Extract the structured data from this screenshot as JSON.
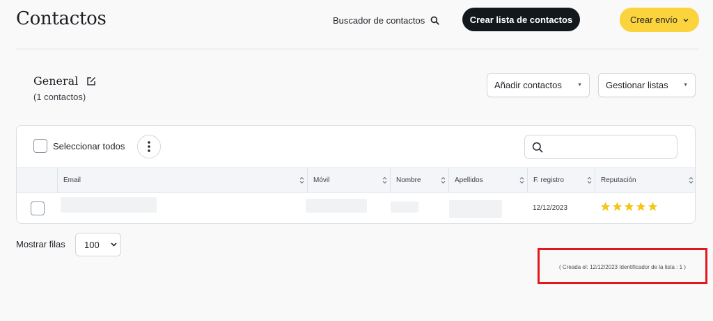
{
  "header": {
    "title": "Contactos",
    "search_label": "Buscador de contactos",
    "create_list_label": "Crear lista de contactos",
    "create_send_label": "Crear envío"
  },
  "list": {
    "name": "General",
    "count_text": "(1 contactos)",
    "add_contacts_label": "Añadir contactos",
    "manage_lists_label": "Gestionar listas"
  },
  "table": {
    "select_all_label": "Seleccionar todos",
    "search_value": "",
    "columns": [
      "Email",
      "Móvil",
      "Nombre",
      "Apellidos",
      "F. registro",
      "Reputación"
    ],
    "rows": [
      {
        "registration_date": "12/12/2023",
        "reputation_stars": 5
      }
    ]
  },
  "footer": {
    "rows_label": "Mostrar filas",
    "rows_value": "100",
    "meta_text": "( Creada el: 12/12/2023 Identificador de la lista : 1 )"
  },
  "colors": {
    "accent_dark": "#13181d",
    "accent_yellow": "#fbd33c",
    "star": "#f5c518",
    "highlight_box": "#e3181c"
  },
  "icons": {
    "search": "search-icon",
    "edit": "edit-icon",
    "chevron": "chevron-down-icon",
    "caret": "caret-down-icon",
    "kebab": "more-vertical-icon",
    "sort": "sort-icon",
    "star": "star-icon"
  }
}
